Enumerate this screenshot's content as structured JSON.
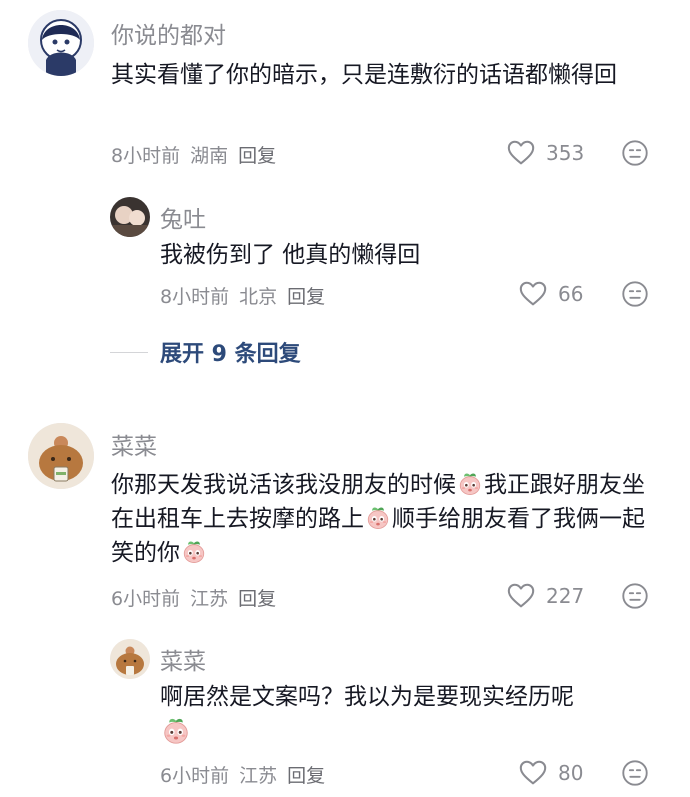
{
  "comments": [
    {
      "username": "你说的都对",
      "text": "其实看懂了你的暗示，只是连敷衍的话语都懒得回",
      "time": "8小时前",
      "location": "湖南",
      "reply": "回复",
      "likes": "353"
    },
    {
      "username": "兔吐",
      "text": "我被伤到了 他真的懒得回",
      "time": "8小时前",
      "location": "北京",
      "reply": "回复",
      "likes": "66"
    },
    {
      "username": "菜菜",
      "text_parts": [
        "你那天发我说活该我没朋友的时候",
        "我正跟好朋友坐在出租车上去按摩的路上",
        "顺手给朋友看了我俩一起笑的你"
      ],
      "time": "6小时前",
      "location": "江苏",
      "reply": "回复",
      "likes": "227"
    },
    {
      "username": "菜菜",
      "text": "啊居然是文案吗？我以为是要现实经历呢",
      "time": "6小时前",
      "location": "江苏",
      "reply": "回复",
      "likes": "80"
    }
  ],
  "expand": {
    "label": "展开 9 条回复"
  },
  "icons": {
    "like": "heart-outline-icon",
    "dislike": "meh-face-icon",
    "emoji": "peach-emoji-icon"
  },
  "colors": {
    "username": "#8a8b91",
    "text": "#161823",
    "expand_link": "#2d4a7a"
  }
}
